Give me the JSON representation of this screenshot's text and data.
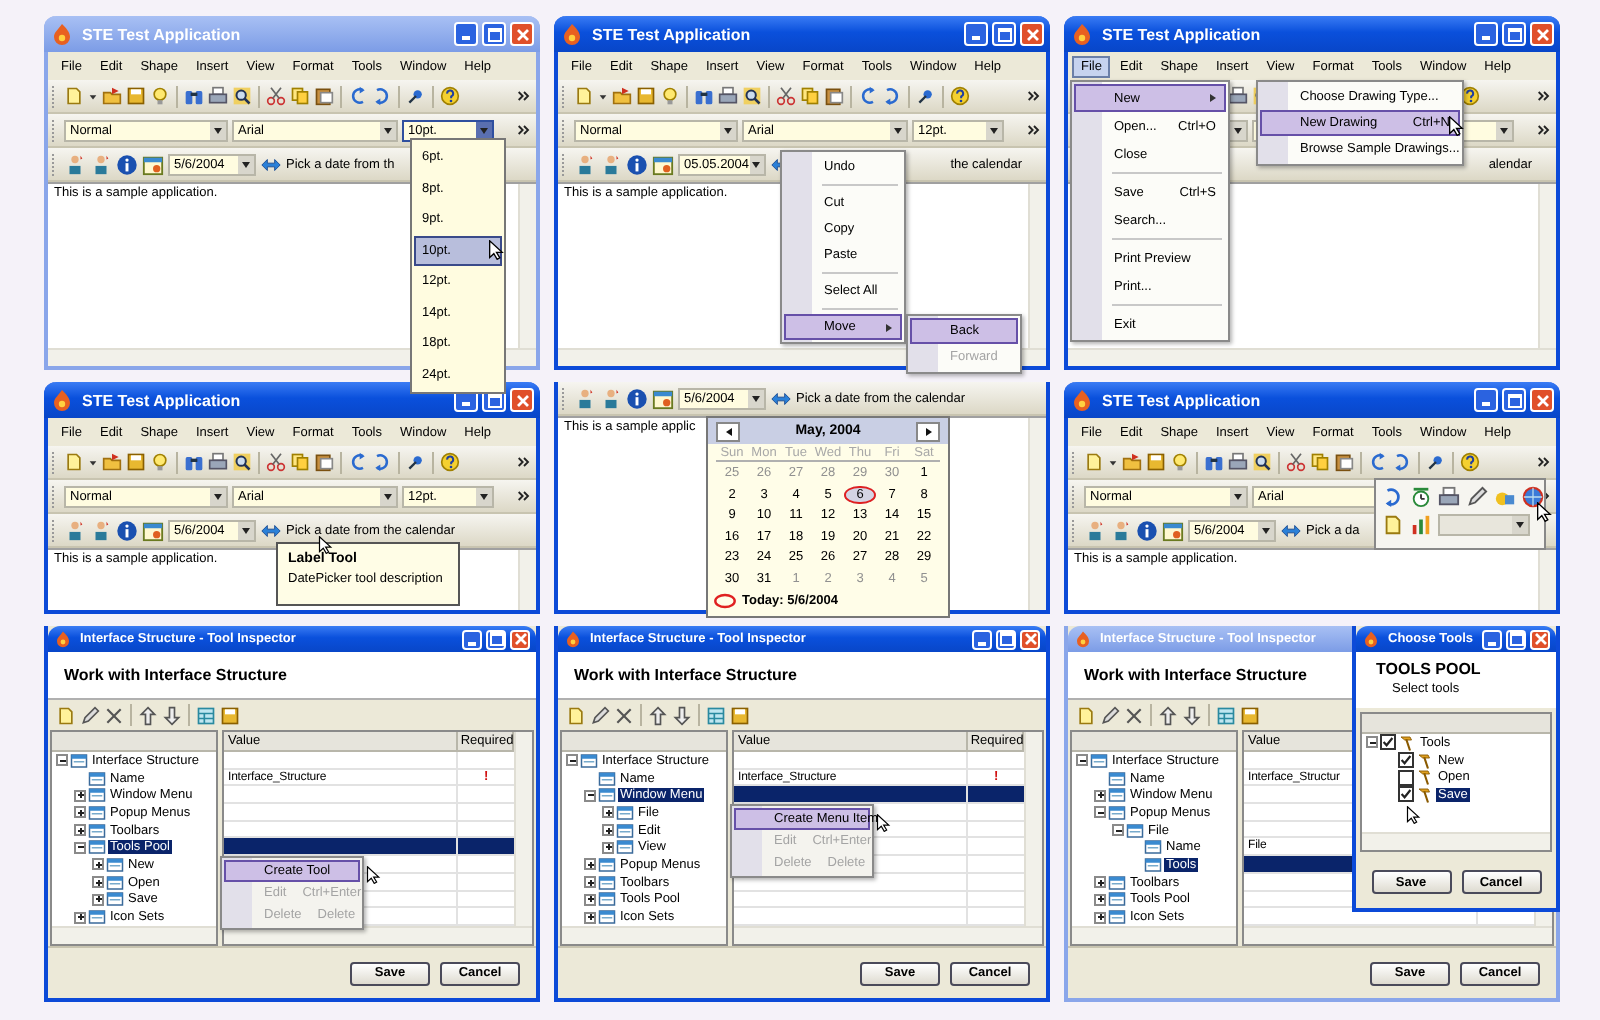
{
  "panels": [
    {
      "kind": "app",
      "title": "STE Test Application",
      "active": false,
      "menu": [
        {
          "label": "File",
          "selected": false
        },
        {
          "label": "Edit",
          "selected": false
        },
        {
          "label": "Shape",
          "selected": false
        },
        {
          "label": "Insert",
          "selected": false
        },
        {
          "label": "View",
          "selected": false
        },
        {
          "label": "Format",
          "selected": false
        },
        {
          "label": "Tools",
          "selected": false
        },
        {
          "label": "Window",
          "selected": false
        },
        {
          "label": "Help",
          "selected": false
        }
      ],
      "format": {
        "style": "Normal",
        "font": "Arial",
        "size": "10pt.",
        "size_focused": true
      },
      "datebar": {
        "date": "5/6/2004",
        "label": "Pick a date from th"
      },
      "text": "This is a sample application.",
      "overlay": {
        "kind": "dropdown",
        "options": [
          {
            "label": "6pt.",
            "selected": false
          },
          {
            "label": "8pt.",
            "selected": false
          },
          {
            "label": "9pt.",
            "selected": false
          },
          {
            "label": "10pt.",
            "selected": true
          },
          {
            "label": "12pt.",
            "selected": false
          },
          {
            "label": "14pt.",
            "selected": false
          },
          {
            "label": "18pt.",
            "selected": false
          },
          {
            "label": "24pt.",
            "selected": false
          }
        ]
      }
    },
    {
      "kind": "app",
      "title": "STE Test Application",
      "active": true,
      "menu": [
        {
          "label": "File",
          "selected": false
        },
        {
          "label": "Edit",
          "selected": false
        },
        {
          "label": "Shape",
          "selected": false
        },
        {
          "label": "Insert",
          "selected": false
        },
        {
          "label": "View",
          "selected": false
        },
        {
          "label": "Format",
          "selected": false
        },
        {
          "label": "Tools",
          "selected": false
        },
        {
          "label": "Window",
          "selected": false
        },
        {
          "label": "Help",
          "selected": false
        }
      ],
      "format": {
        "style": "Normal",
        "font": "Arial",
        "size": "12pt.",
        "size_focused": false
      },
      "datebar": {
        "date": "05.05.2004",
        "label": "the calendar"
      },
      "text": "This is a sample application.",
      "overlay": {
        "kind": "context_menu",
        "items": [
          {
            "label": "Undo",
            "selected": false,
            "disabled": false
          },
          {
            "label": "Cut",
            "selected": false,
            "disabled": false,
            "separator_before": true
          },
          {
            "label": "Copy",
            "selected": false,
            "disabled": false
          },
          {
            "label": "Paste",
            "selected": false,
            "disabled": false
          },
          {
            "label": "Select All",
            "selected": false,
            "disabled": false,
            "separator_before": true
          },
          {
            "label": "Move",
            "selected": true,
            "disabled": false,
            "separator_before": true,
            "submenu": [
              {
                "label": "Back",
                "selected": true,
                "disabled": false
              },
              {
                "label": "Forward",
                "selected": false,
                "disabled": true
              }
            ]
          }
        ]
      }
    },
    {
      "kind": "app",
      "title": "STE Test Application",
      "active": true,
      "menu": [
        {
          "label": "File",
          "selected": true
        },
        {
          "label": "Edit",
          "selected": false
        },
        {
          "label": "Shape",
          "selected": false
        },
        {
          "label": "Insert",
          "selected": false
        },
        {
          "label": "View",
          "selected": false
        },
        {
          "label": "Format",
          "selected": false
        },
        {
          "label": "Tools",
          "selected": false
        },
        {
          "label": "Window",
          "selected": false
        },
        {
          "label": "Help",
          "selected": false
        }
      ],
      "datebar": {
        "label": "alendar"
      },
      "overlay": {
        "kind": "file_menu",
        "items": [
          {
            "label": "New",
            "selected": true,
            "disabled": false,
            "submenu": [
              {
                "label": "Choose Drawing Type...",
                "selected": false,
                "disabled": false
              },
              {
                "label": "New Drawing",
                "shortcut": "Ctrl+N",
                "selected": true,
                "disabled": false
              },
              {
                "label": "Browse Sample Drawings...",
                "selected": false,
                "disabled": false
              }
            ]
          },
          {
            "label": "Open...",
            "shortcut": "Ctrl+O",
            "selected": false,
            "disabled": false
          },
          {
            "label": "Close",
            "selected": false,
            "disabled": false
          },
          {
            "label": "Save",
            "shortcut": "Ctrl+S",
            "selected": false,
            "disabled": false,
            "separator_before": true
          },
          {
            "label": "Search...",
            "selected": false,
            "disabled": false
          },
          {
            "label": "Print Preview",
            "selected": false,
            "disabled": false,
            "separator_before": true
          },
          {
            "label": "Print...",
            "selected": false,
            "disabled": false
          },
          {
            "label": "Exit",
            "selected": false,
            "disabled": false,
            "separator_before": true
          }
        ]
      }
    },
    {
      "kind": "app",
      "title": "STE Test Application",
      "active": true,
      "menu": [
        {
          "label": "File",
          "selected": false
        },
        {
          "label": "Edit",
          "selected": false
        },
        {
          "label": "Shape",
          "selected": false
        },
        {
          "label": "Insert",
          "selected": false
        },
        {
          "label": "View",
          "selected": false
        },
        {
          "label": "Format",
          "selected": false
        },
        {
          "label": "Tools",
          "selected": false
        },
        {
          "label": "Window",
          "selected": false
        },
        {
          "label": "Help",
          "selected": false
        }
      ],
      "format": {
        "style": "Normal",
        "font": "Arial",
        "size": "12pt.",
        "size_focused": false
      },
      "datebar": {
        "date": "5/6/2004",
        "label": "Pick a date from the calendar"
      },
      "text": "This is a sample application.",
      "overlay": {
        "kind": "tooltip",
        "title": "Label Tool",
        "text": "DatePicker tool description"
      }
    },
    {
      "kind": "app",
      "datebar": {
        "date": "5/6/2004",
        "label": "Pick a date from the calendar"
      },
      "text": "This is a sample applic",
      "overlay": {
        "kind": "calendar",
        "month": "May, 2004",
        "weekdays": [
          "Sun",
          "Mon",
          "Tue",
          "Wed",
          "Thu",
          "Fri",
          "Sat"
        ],
        "today": "Today: 5/6/2004",
        "days": [
          {
            "label": "25",
            "muted": true,
            "selected": false
          },
          {
            "label": "26",
            "muted": true,
            "selected": false
          },
          {
            "label": "27",
            "muted": true,
            "selected": false
          },
          {
            "label": "28",
            "muted": true,
            "selected": false
          },
          {
            "label": "29",
            "muted": true,
            "selected": false
          },
          {
            "label": "30",
            "muted": true,
            "selected": false
          },
          {
            "label": "1",
            "muted": false,
            "selected": false
          },
          {
            "label": "2",
            "muted": false,
            "selected": false
          },
          {
            "label": "3",
            "muted": false,
            "selected": false
          },
          {
            "label": "4",
            "muted": false,
            "selected": false
          },
          {
            "label": "5",
            "muted": false,
            "selected": false
          },
          {
            "label": "6",
            "muted": false,
            "selected": true
          },
          {
            "label": "7",
            "muted": false,
            "selected": false
          },
          {
            "label": "8",
            "muted": false,
            "selected": false
          },
          {
            "label": "9",
            "muted": false,
            "selected": false
          },
          {
            "label": "10",
            "muted": false,
            "selected": false
          },
          {
            "label": "11",
            "muted": false,
            "selected": false
          },
          {
            "label": "12",
            "muted": false,
            "selected": false
          },
          {
            "label": "13",
            "muted": false,
            "selected": false
          },
          {
            "label": "14",
            "muted": false,
            "selected": false
          },
          {
            "label": "15",
            "muted": false,
            "selected": false
          },
          {
            "label": "16",
            "muted": false,
            "selected": false
          },
          {
            "label": "17",
            "muted": false,
            "selected": false
          },
          {
            "label": "18",
            "muted": false,
            "selected": false
          },
          {
            "label": "19",
            "muted": false,
            "selected": false
          },
          {
            "label": "20",
            "muted": false,
            "selected": false
          },
          {
            "label": "21",
            "muted": false,
            "selected": false
          },
          {
            "label": "22",
            "muted": false,
            "selected": false
          },
          {
            "label": "23",
            "muted": false,
            "selected": false
          },
          {
            "label": "24",
            "muted": false,
            "selected": false
          },
          {
            "label": "25",
            "muted": false,
            "selected": false
          },
          {
            "label": "26",
            "muted": false,
            "selected": false
          },
          {
            "label": "27",
            "muted": false,
            "selected": false
          },
          {
            "label": "28",
            "muted": false,
            "selected": false
          },
          {
            "label": "29",
            "muted": false,
            "selected": false
          },
          {
            "label": "30",
            "muted": false,
            "selected": false
          },
          {
            "label": "31",
            "muted": false,
            "selected": false
          },
          {
            "label": "1",
            "muted": true,
            "selected": false
          },
          {
            "label": "2",
            "muted": true,
            "selected": false
          },
          {
            "label": "3",
            "muted": true,
            "selected": false
          },
          {
            "label": "4",
            "muted": true,
            "selected": false
          },
          {
            "label": "5",
            "muted": true,
            "selected": false
          }
        ]
      }
    },
    {
      "kind": "app",
      "title": "STE Test Application",
      "active": true,
      "menu": [
        {
          "label": "File",
          "selected": false
        },
        {
          "label": "Edit",
          "selected": false
        },
        {
          "label": "Shape",
          "selected": false
        },
        {
          "label": "Insert",
          "selected": false
        },
        {
          "label": "View",
          "selected": false
        },
        {
          "label": "Format",
          "selected": false
        },
        {
          "label": "Tools",
          "selected": false
        },
        {
          "label": "Window",
          "selected": false
        },
        {
          "label": "Help",
          "selected": false
        }
      ],
      "format": {
        "style": "Normal",
        "font": "Arial"
      },
      "datebar": {
        "date": "5/6/2004",
        "label": "Pick a da"
      },
      "text": "This is a sample application.",
      "overlay": {
        "kind": "toolbar_popup"
      }
    },
    {
      "kind": "inspector",
      "title": "Interface Structure - Tool Inspector",
      "active": true,
      "heading": "Work with Interface Structure",
      "columns": [
        "Value",
        "Required"
      ],
      "tree": [
        {
          "label": "Interface Structure",
          "expanded": true,
          "selected": false,
          "children": [
            {
              "label": "Name",
              "selected": false
            },
            {
              "label": "Window Menu",
              "expanded": false,
              "selected": false
            },
            {
              "label": "Popup Menus",
              "expanded": false,
              "selected": false
            },
            {
              "label": "Toolbars",
              "expanded": false,
              "selected": false
            },
            {
              "label": "Tools Pool",
              "expanded": true,
              "selected": true,
              "children": [
                {
                  "label": "New",
                  "expanded": false,
                  "selected": false
                },
                {
                  "label": "Open",
                  "expanded": false,
                  "selected": false
                },
                {
                  "label": "Save",
                  "expanded": false,
                  "selected": false
                }
              ]
            },
            {
              "label": "Icon Sets",
              "expanded": false,
              "selected": false
            }
          ]
        }
      ],
      "rows": [
        {
          "selected": false
        },
        {
          "value": "Interface_Structure",
          "required": "!",
          "selected": false
        },
        {
          "selected": false
        },
        {
          "selected": false
        },
        {
          "selected": false
        },
        {
          "selected": true
        },
        {
          "selected": false
        },
        {
          "selected": false
        },
        {
          "selected": false
        },
        {
          "selected": false
        }
      ],
      "buttons": [
        "Save",
        "Cancel"
      ],
      "overlay": {
        "kind": "context_menu",
        "items": [
          {
            "label": "Create Tool",
            "selected": true,
            "disabled": false
          },
          {
            "label": "Edit",
            "shortcut": "Ctrl+Enter",
            "selected": false,
            "disabled": true
          },
          {
            "label": "Delete",
            "shortcut": "Delete",
            "selected": false,
            "disabled": true
          }
        ]
      }
    },
    {
      "kind": "inspector",
      "title": "Interface Structure - Tool Inspector",
      "active": true,
      "heading": "Work with Interface Structure",
      "columns": [
        "Value",
        "Required"
      ],
      "tree": [
        {
          "label": "Interface Structure",
          "expanded": true,
          "selected": false,
          "children": [
            {
              "label": "Name",
              "selected": false
            },
            {
              "label": "Window Menu",
              "expanded": true,
              "selected": true,
              "children": [
                {
                  "label": "File",
                  "expanded": false,
                  "selected": false
                },
                {
                  "label": "Edit",
                  "expanded": false,
                  "selected": false
                },
                {
                  "label": "View",
                  "expanded": false,
                  "selected": false
                }
              ]
            },
            {
              "label": "Popup Menus",
              "expanded": false,
              "selected": false
            },
            {
              "label": "Toolbars",
              "expanded": false,
              "selected": false
            },
            {
              "label": "Tools Pool",
              "expanded": false,
              "selected": false
            },
            {
              "label": "Icon Sets",
              "expanded": false,
              "selected": false
            }
          ]
        }
      ],
      "rows": [
        {
          "selected": false
        },
        {
          "value": "Interface_Structure",
          "required": "!",
          "selected": false
        },
        {
          "selected": true
        },
        {
          "selected": false
        },
        {
          "selected": false
        },
        {
          "selected": false
        },
        {
          "selected": false
        },
        {
          "selected": false
        },
        {
          "selected": false
        },
        {
          "selected": false
        }
      ],
      "buttons": [
        "Save",
        "Cancel"
      ],
      "overlay": {
        "kind": "context_menu",
        "items": [
          {
            "label": "Create Menu Item",
            "selected": true,
            "disabled": false
          },
          {
            "label": "Edit",
            "shortcut": "Ctrl+Enter",
            "selected": false,
            "disabled": true
          },
          {
            "label": "Delete",
            "shortcut": "Delete",
            "selected": false,
            "disabled": true
          }
        ]
      }
    },
    {
      "kind": "inspector",
      "title": "Interface Structure - Tool Inspector",
      "active": false,
      "heading": "Work with Interface Structure",
      "columns": [
        "Value"
      ],
      "tree": [
        {
          "label": "Interface Structure",
          "expanded": true,
          "selected": false,
          "children": [
            {
              "label": "Name",
              "selected": false
            },
            {
              "label": "Window Menu",
              "expanded": false,
              "selected": false
            },
            {
              "label": "Popup Menus",
              "expanded": true,
              "selected": false,
              "children": [
                {
                  "label": "File",
                  "expanded": true,
                  "selected": false,
                  "children": [
                    {
                      "label": "Name",
                      "selected": false
                    },
                    {
                      "label": "Tools",
                      "selected": true
                    }
                  ]
                }
              ]
            },
            {
              "label": "Toolbars",
              "expanded": false,
              "selected": false
            },
            {
              "label": "Tools Pool",
              "expanded": false,
              "selected": false
            },
            {
              "label": "Icon Sets",
              "expanded": false,
              "selected": false
            }
          ]
        }
      ],
      "rows": [
        {
          "selected": false
        },
        {
          "value": "Interface_Structur",
          "selected": false
        },
        {
          "selected": false
        },
        {
          "selected": false
        },
        {
          "selected": false
        },
        {
          "value": "File",
          "selected": false
        },
        {
          "selected": true
        },
        {
          "selected": false
        },
        {
          "selected": false
        },
        {
          "selected": false
        }
      ],
      "buttons": [
        "Save",
        "Cancel"
      ],
      "overlay": {
        "kind": "dialog",
        "title": "Choose Tools",
        "active": true,
        "heading": "TOOLS POOL",
        "subheading": "Select tools",
        "tree": [
          {
            "label": "Tools",
            "expanded": true,
            "checked": true,
            "selected": false,
            "children": [
              {
                "label": "New",
                "checked": true,
                "selected": false
              },
              {
                "label": "Open",
                "checked": false,
                "selected": false
              },
              {
                "label": "Save",
                "checked": true,
                "selected": true
              }
            ]
          }
        ],
        "buttons": [
          "Save",
          "Cancel"
        ]
      }
    }
  ]
}
